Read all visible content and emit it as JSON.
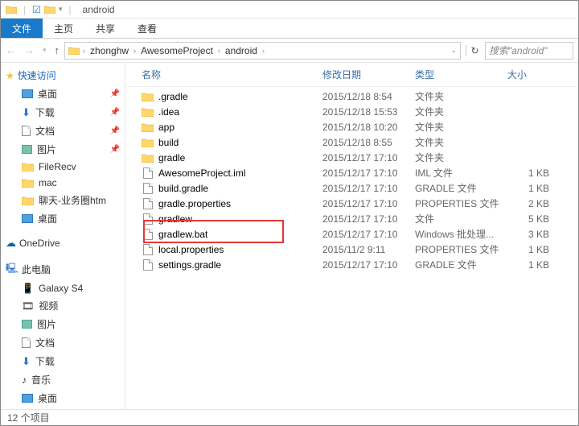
{
  "titlebar": {
    "title": "android"
  },
  "ribbon": {
    "file": "文件",
    "home": "主页",
    "share": "共享",
    "view": "查看"
  },
  "breadcrumb": {
    "items": [
      "zhonghw",
      "AwesomeProject",
      "android"
    ],
    "refresh_glyph": "↻"
  },
  "search": {
    "placeholder": "搜索\"android\""
  },
  "sidebar": {
    "quick_access": "快速访问",
    "quick_items": [
      {
        "label": "桌面",
        "icon": "desktop"
      },
      {
        "label": "下载",
        "icon": "download"
      },
      {
        "label": "文档",
        "icon": "doc"
      },
      {
        "label": "图片",
        "icon": "pic"
      },
      {
        "label": "FileRecv",
        "icon": "folder"
      },
      {
        "label": "mac",
        "icon": "folder"
      },
      {
        "label": "聊天-业务圈htm",
        "icon": "folder"
      },
      {
        "label": "桌面",
        "icon": "desktop"
      }
    ],
    "onedrive": "OneDrive",
    "this_pc": "此电脑",
    "pc_items": [
      {
        "label": "Galaxy S4",
        "icon": "device"
      },
      {
        "label": "视频",
        "icon": "video"
      },
      {
        "label": "图片",
        "icon": "pic"
      },
      {
        "label": "文档",
        "icon": "doc"
      },
      {
        "label": "下载",
        "icon": "download"
      },
      {
        "label": "音乐",
        "icon": "music"
      },
      {
        "label": "桌面",
        "icon": "desktop"
      }
    ]
  },
  "columns": {
    "name": "名称",
    "date": "修改日期",
    "type": "类型",
    "size": "大小"
  },
  "files": [
    {
      "name": ".gradle",
      "date": "2015/12/18 8:54",
      "type": "文件夹",
      "size": "",
      "kind": "folder"
    },
    {
      "name": ".idea",
      "date": "2015/12/18 15:53",
      "type": "文件夹",
      "size": "",
      "kind": "folder"
    },
    {
      "name": "app",
      "date": "2015/12/18 10:20",
      "type": "文件夹",
      "size": "",
      "kind": "folder"
    },
    {
      "name": "build",
      "date": "2015/12/18 8:55",
      "type": "文件夹",
      "size": "",
      "kind": "folder"
    },
    {
      "name": "gradle",
      "date": "2015/12/17 17:10",
      "type": "文件夹",
      "size": "",
      "kind": "folder"
    },
    {
      "name": "AwesomeProject.iml",
      "date": "2015/12/17 17:10",
      "type": "IML 文件",
      "size": "1 KB",
      "kind": "file"
    },
    {
      "name": "build.gradle",
      "date": "2015/12/17 17:10",
      "type": "GRADLE 文件",
      "size": "1 KB",
      "kind": "file"
    },
    {
      "name": "gradle.properties",
      "date": "2015/12/17 17:10",
      "type": "PROPERTIES 文件",
      "size": "2 KB",
      "kind": "file"
    },
    {
      "name": "gradlew",
      "date": "2015/12/17 17:10",
      "type": "文件",
      "size": "5 KB",
      "kind": "file"
    },
    {
      "name": "gradlew.bat",
      "date": "2015/12/17 17:10",
      "type": "Windows 批处理...",
      "size": "3 KB",
      "kind": "file"
    },
    {
      "name": "local.properties",
      "date": "2015/11/2 9:11",
      "type": "PROPERTIES 文件",
      "size": "1 KB",
      "kind": "file",
      "highlighted": true
    },
    {
      "name": "settings.gradle",
      "date": "2015/12/17 17:10",
      "type": "GRADLE 文件",
      "size": "1 KB",
      "kind": "file"
    }
  ],
  "status": {
    "count": "12 个项目"
  }
}
